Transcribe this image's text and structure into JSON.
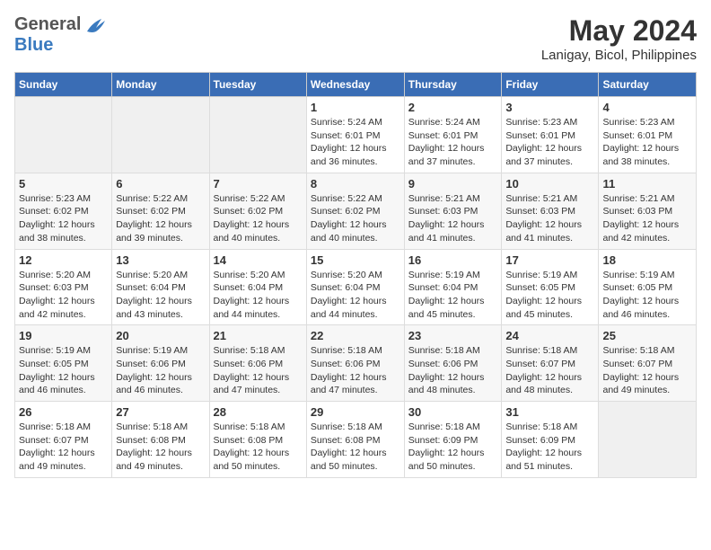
{
  "header": {
    "logo_general": "General",
    "logo_blue": "Blue",
    "month_year": "May 2024",
    "location": "Lanigay, Bicol, Philippines"
  },
  "days_of_week": [
    "Sunday",
    "Monday",
    "Tuesday",
    "Wednesday",
    "Thursday",
    "Friday",
    "Saturday"
  ],
  "weeks": [
    [
      {
        "day": "",
        "info": ""
      },
      {
        "day": "",
        "info": ""
      },
      {
        "day": "",
        "info": ""
      },
      {
        "day": "1",
        "info": "Sunrise: 5:24 AM\nSunset: 6:01 PM\nDaylight: 12 hours\nand 36 minutes."
      },
      {
        "day": "2",
        "info": "Sunrise: 5:24 AM\nSunset: 6:01 PM\nDaylight: 12 hours\nand 37 minutes."
      },
      {
        "day": "3",
        "info": "Sunrise: 5:23 AM\nSunset: 6:01 PM\nDaylight: 12 hours\nand 37 minutes."
      },
      {
        "day": "4",
        "info": "Sunrise: 5:23 AM\nSunset: 6:01 PM\nDaylight: 12 hours\nand 38 minutes."
      }
    ],
    [
      {
        "day": "5",
        "info": "Sunrise: 5:23 AM\nSunset: 6:02 PM\nDaylight: 12 hours\nand 38 minutes."
      },
      {
        "day": "6",
        "info": "Sunrise: 5:22 AM\nSunset: 6:02 PM\nDaylight: 12 hours\nand 39 minutes."
      },
      {
        "day": "7",
        "info": "Sunrise: 5:22 AM\nSunset: 6:02 PM\nDaylight: 12 hours\nand 40 minutes."
      },
      {
        "day": "8",
        "info": "Sunrise: 5:22 AM\nSunset: 6:02 PM\nDaylight: 12 hours\nand 40 minutes."
      },
      {
        "day": "9",
        "info": "Sunrise: 5:21 AM\nSunset: 6:03 PM\nDaylight: 12 hours\nand 41 minutes."
      },
      {
        "day": "10",
        "info": "Sunrise: 5:21 AM\nSunset: 6:03 PM\nDaylight: 12 hours\nand 41 minutes."
      },
      {
        "day": "11",
        "info": "Sunrise: 5:21 AM\nSunset: 6:03 PM\nDaylight: 12 hours\nand 42 minutes."
      }
    ],
    [
      {
        "day": "12",
        "info": "Sunrise: 5:20 AM\nSunset: 6:03 PM\nDaylight: 12 hours\nand 42 minutes."
      },
      {
        "day": "13",
        "info": "Sunrise: 5:20 AM\nSunset: 6:04 PM\nDaylight: 12 hours\nand 43 minutes."
      },
      {
        "day": "14",
        "info": "Sunrise: 5:20 AM\nSunset: 6:04 PM\nDaylight: 12 hours\nand 44 minutes."
      },
      {
        "day": "15",
        "info": "Sunrise: 5:20 AM\nSunset: 6:04 PM\nDaylight: 12 hours\nand 44 minutes."
      },
      {
        "day": "16",
        "info": "Sunrise: 5:19 AM\nSunset: 6:04 PM\nDaylight: 12 hours\nand 45 minutes."
      },
      {
        "day": "17",
        "info": "Sunrise: 5:19 AM\nSunset: 6:05 PM\nDaylight: 12 hours\nand 45 minutes."
      },
      {
        "day": "18",
        "info": "Sunrise: 5:19 AM\nSunset: 6:05 PM\nDaylight: 12 hours\nand 46 minutes."
      }
    ],
    [
      {
        "day": "19",
        "info": "Sunrise: 5:19 AM\nSunset: 6:05 PM\nDaylight: 12 hours\nand 46 minutes."
      },
      {
        "day": "20",
        "info": "Sunrise: 5:19 AM\nSunset: 6:06 PM\nDaylight: 12 hours\nand 46 minutes."
      },
      {
        "day": "21",
        "info": "Sunrise: 5:18 AM\nSunset: 6:06 PM\nDaylight: 12 hours\nand 47 minutes."
      },
      {
        "day": "22",
        "info": "Sunrise: 5:18 AM\nSunset: 6:06 PM\nDaylight: 12 hours\nand 47 minutes."
      },
      {
        "day": "23",
        "info": "Sunrise: 5:18 AM\nSunset: 6:06 PM\nDaylight: 12 hours\nand 48 minutes."
      },
      {
        "day": "24",
        "info": "Sunrise: 5:18 AM\nSunset: 6:07 PM\nDaylight: 12 hours\nand 48 minutes."
      },
      {
        "day": "25",
        "info": "Sunrise: 5:18 AM\nSunset: 6:07 PM\nDaylight: 12 hours\nand 49 minutes."
      }
    ],
    [
      {
        "day": "26",
        "info": "Sunrise: 5:18 AM\nSunset: 6:07 PM\nDaylight: 12 hours\nand 49 minutes."
      },
      {
        "day": "27",
        "info": "Sunrise: 5:18 AM\nSunset: 6:08 PM\nDaylight: 12 hours\nand 49 minutes."
      },
      {
        "day": "28",
        "info": "Sunrise: 5:18 AM\nSunset: 6:08 PM\nDaylight: 12 hours\nand 50 minutes."
      },
      {
        "day": "29",
        "info": "Sunrise: 5:18 AM\nSunset: 6:08 PM\nDaylight: 12 hours\nand 50 minutes."
      },
      {
        "day": "30",
        "info": "Sunrise: 5:18 AM\nSunset: 6:09 PM\nDaylight: 12 hours\nand 50 minutes."
      },
      {
        "day": "31",
        "info": "Sunrise: 5:18 AM\nSunset: 6:09 PM\nDaylight: 12 hours\nand 51 minutes."
      },
      {
        "day": "",
        "info": ""
      }
    ]
  ]
}
